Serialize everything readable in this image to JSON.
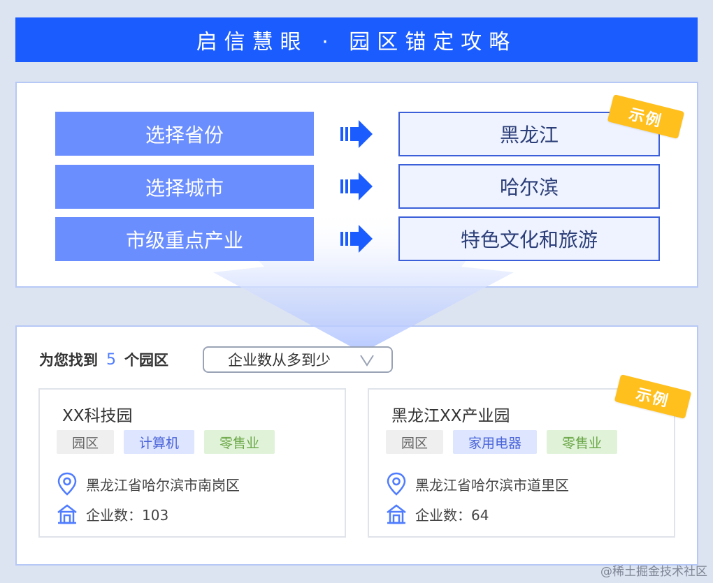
{
  "header": {
    "title": "启信慧眼 · 园区锚定攻略"
  },
  "steps": [
    {
      "label": "选择省份",
      "value": "黑龙江"
    },
    {
      "label": "选择城市",
      "value": "哈尔滨"
    },
    {
      "label": "市级重点产业",
      "value": "特色文化和旅游"
    }
  ],
  "badge": {
    "label": "示例"
  },
  "results": {
    "prefix": "为您找到",
    "count": "5",
    "suffix": "个园区",
    "sort_value": "企业数从多到少"
  },
  "parks": [
    {
      "name": "XX科技园",
      "tags": [
        "园区",
        "计算机",
        "零售业"
      ],
      "address": "黑龙江省哈尔滨市南岗区",
      "enterprise_count": "企业数：103"
    },
    {
      "name": "黑龙江XX产业园",
      "tags": [
        "园区",
        "家用电器",
        "零售业"
      ],
      "address": "黑龙江省哈尔滨市道里区",
      "enterprise_count": "企业数：64"
    }
  ],
  "watermark": "@稀土掘金技术社区",
  "colors": {
    "title_bar": "#1b5cff",
    "step_fill": "#6b8eff",
    "result_border": "#3b5fd8",
    "badge": "#ffc01e",
    "count_accent": "#4f7cff"
  },
  "icons": [
    "double-arrow-right-icon",
    "location-pin-icon",
    "building-icon",
    "chevron-down-icon"
  ]
}
